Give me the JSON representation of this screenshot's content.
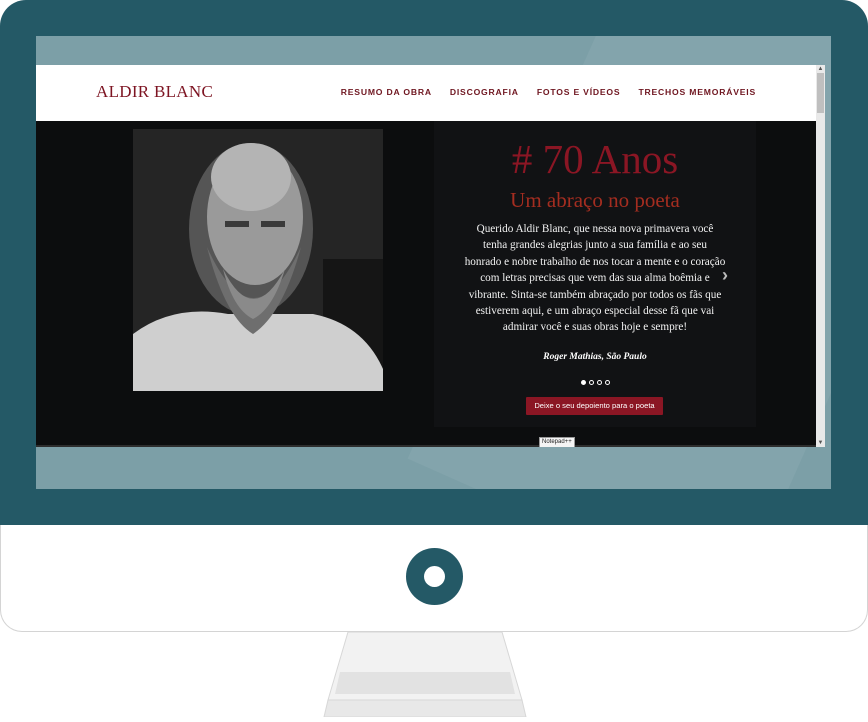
{
  "site": {
    "brand": "ALDIR BLANC",
    "menu": [
      "RESUMO DA OBRA",
      "DISCOGRAFIA",
      "FOTOS E VÍDEOS",
      "TRECHOS MEMORÁVEIS"
    ]
  },
  "hero": {
    "title": "# 70 Anos",
    "subtitle": "Um abraço no poeta",
    "quote": "Querido Aldir Blanc, que nessa nova primavera você tenha grandes alegrias junto a sua família e ao seu honrado e nobre trabalho de nos tocar a mente e o coração com letras precisas que vem das sua alma boêmia e vibrante. Sinta-se também abraçado por todos os fãs que estiverem aqui, e um abraço especial desse fã que vai admirar você e suas obras hoje e sempre!",
    "author": "Roger Mathias, São Paulo",
    "slides_total": 4,
    "slide_active": 1,
    "cta_label": "Deixe o seu depoiento para o poeta"
  },
  "taskbar_tooltip": "Notepad++",
  "colors": {
    "bezel": "#245966",
    "accent": "#8b1624",
    "subtitle": "#a42d20",
    "screen_bg": "#7c9fa7"
  },
  "icons": {
    "prev": "chevron-left-icon",
    "next": "chevron-right-icon",
    "monitor_logo": "ring-logo-icon"
  }
}
